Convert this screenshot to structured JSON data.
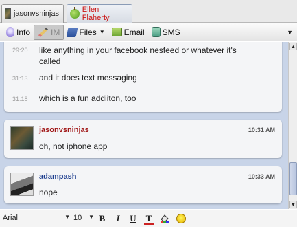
{
  "tabs": [
    {
      "label": "jasonvsninjas",
      "active": true
    },
    {
      "label": "Ellen Flaherty",
      "active": false
    }
  ],
  "toolbar": {
    "info": "Info",
    "im": "IM",
    "files": "Files",
    "email": "Email",
    "sms": "SMS"
  },
  "conversation": {
    "messages": [
      {
        "time": "29:20",
        "text": "like anything in your facebook nesfeed or whatever it's called"
      },
      {
        "time": "31:13",
        "text": "and it does text messaging"
      },
      {
        "time": "31:18",
        "text": "which is a fun addiiton, too"
      }
    ],
    "blocks": [
      {
        "sender": "jasonvsninjas",
        "time": "10:31 AM",
        "text": "oh, not iphone app"
      },
      {
        "sender": "adampash",
        "time": "10:33 AM",
        "text": "nope"
      }
    ]
  },
  "format": {
    "font": "Arial",
    "size": "10",
    "bold": "B",
    "italic": "I",
    "underline": "U",
    "text_color": "T"
  }
}
